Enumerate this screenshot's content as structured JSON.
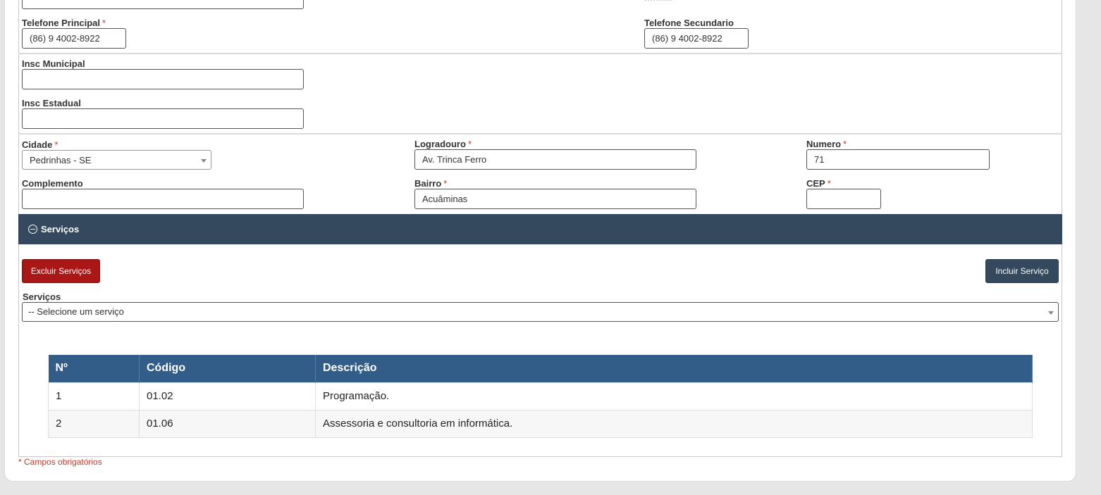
{
  "contact": {
    "phone_primary": {
      "label": "Telefone Principal",
      "required": "*",
      "value": "(86) 9 4002-8922"
    },
    "phone_secondary": {
      "label": "Telefone Secundario",
      "value": "(86) 9 4002-8922"
    }
  },
  "registration": {
    "municipal": {
      "label": "Insc Municipal",
      "value": ""
    },
    "state": {
      "label": "Insc Estadual",
      "value": ""
    }
  },
  "address": {
    "city": {
      "label": "Cidade",
      "required": "*",
      "value": "Pedrinhas - SE"
    },
    "street": {
      "label": "Logradouro",
      "required": "*",
      "value": "Av. Trinca Ferro"
    },
    "number": {
      "label": "Numero",
      "required": "*",
      "value": "71"
    },
    "complement": {
      "label": "Complemento",
      "value": ""
    },
    "district": {
      "label": "Bairro",
      "required": "*",
      "value": "Acuâminas"
    },
    "cep": {
      "label": "CEP",
      "required": "*",
      "value": ""
    }
  },
  "services_section": {
    "title": "Serviços",
    "delete_button": "Excluir Serviços",
    "add_button": "Incluir Serviço",
    "select_label": "Serviços",
    "select_value": "-- Selecione um serviço",
    "table": {
      "headers": [
        "Nº",
        "Código",
        "Descrição"
      ],
      "rows": [
        {
          "n": "1",
          "code": "01.02",
          "description": "Programação."
        },
        {
          "n": "2",
          "code": "01.06",
          "description": "Assessoria e consultoria em informática."
        }
      ]
    }
  },
  "footnote": "* Campos obrigatórios",
  "colors": {
    "section_bar": "#34495e",
    "table_header": "#325d88",
    "danger_button": "#a91717",
    "required_mark": "#c0392b"
  }
}
